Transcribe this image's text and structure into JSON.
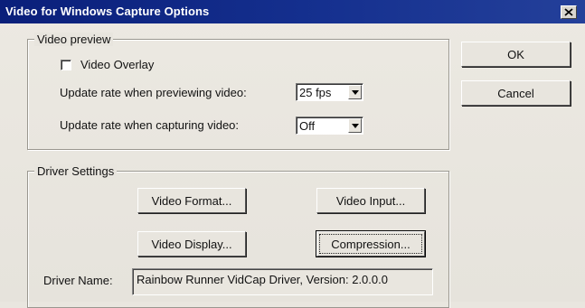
{
  "window": {
    "title": "Video for Windows Capture Options",
    "close_glyph": "✕"
  },
  "buttons": {
    "ok": "OK",
    "cancel": "Cancel"
  },
  "video_preview": {
    "group_label": "Video preview",
    "overlay_label": "Video Overlay",
    "overlay_checked": false,
    "preview_rate_label": "Update rate when previewing video:",
    "preview_rate_value": "25 fps",
    "capture_rate_label": "Update rate when capturing video:",
    "capture_rate_value": "Off"
  },
  "driver_settings": {
    "group_label": "Driver Settings",
    "video_format": "Video Format...",
    "video_input": "Video Input...",
    "video_display": "Video Display...",
    "compression": "Compression...",
    "driver_name_label": "Driver Name:",
    "driver_name_value": "Rainbow Runner VidCap Driver, Version:  2.0.0.0"
  },
  "icons": {
    "close": "close-icon",
    "dropdown": "chevron-down-icon",
    "checkbox": "checkbox-icon"
  },
  "colors": {
    "titlebar": "#0a1f7a",
    "face": "#e9e6df"
  }
}
